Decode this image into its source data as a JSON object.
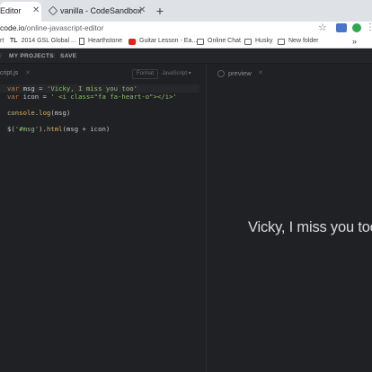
{
  "browser": {
    "tabs": [
      {
        "title": "Editor",
        "close": "✕"
      },
      {
        "title": "vanilla - CodeSandbox",
        "close": "✕"
      }
    ],
    "new_tab": "+",
    "address": {
      "host": "code.io",
      "path": "/online-javascript-editor"
    },
    "bookmarks": [
      {
        "label": "rt",
        "icon": "none"
      },
      {
        "label": "2014 GSL Global ...",
        "icon": "tl-icon",
        "prefix": "TL"
      },
      {
        "label": "Hearthstone",
        "icon": "page-icon"
      },
      {
        "label": "Guitar Lesson - Ea...",
        "icon": "youtube-icon"
      },
      {
        "label": "Online Chat",
        "icon": "folder-icon"
      },
      {
        "label": "Husky",
        "icon": "folder-icon"
      },
      {
        "label": "New folder",
        "icon": "folder-icon"
      }
    ],
    "more": "»"
  },
  "app": {
    "nav": {
      "my_projects": "MY PROJECTS",
      "save": "SAVE"
    }
  },
  "editor": {
    "filename": "cript.js",
    "format_label": "Format",
    "language": "JavaScript ▾",
    "code": {
      "l1": {
        "kw": "var",
        "rest": " msg = ",
        "str": "'Vicky, I miss you too'"
      },
      "l2": {
        "kw": "var",
        "rest": " icon = ",
        "str": "' <i class=\"fa fa-heart-o\"></i>'"
      },
      "l4": {
        "obj": "console",
        "dot": ".",
        "fn": "log",
        "args": "(msg)"
      },
      "l6": {
        "a": "$(",
        "str": "'#msg'",
        "b": ").",
        "fn": "html",
        "c": "(msg + icon)"
      }
    }
  },
  "preview": {
    "title": "preview",
    "output": "Vicky, I miss you too"
  }
}
